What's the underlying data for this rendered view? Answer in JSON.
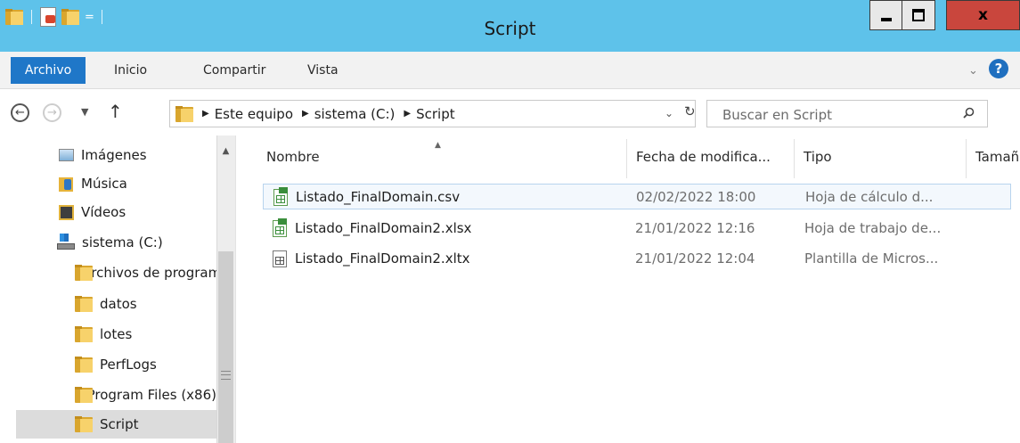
{
  "window": {
    "title": "Script",
    "close_glyph": "x"
  },
  "qat": {
    "dropdown_glyph": "="
  },
  "ribbon": {
    "tabs": [
      "Archivo",
      "Inicio",
      "Compartir",
      "Vista"
    ],
    "active_tab": "Archivo",
    "expand_glyph": "⌄",
    "help_glyph": "?"
  },
  "nav_buttons": {
    "back_glyph": "←",
    "forward_glyph": "→",
    "recent_glyph": "▼",
    "up_glyph": "↑"
  },
  "address": {
    "crumbs": [
      "Este equipo",
      "sistema (C:)",
      "Script"
    ],
    "separator_glyph": "▶",
    "dropdown_glyph": "⌄",
    "refresh_glyph": "↻"
  },
  "search": {
    "placeholder": "Buscar en Script"
  },
  "nav_pane": {
    "items": [
      {
        "label": "Imágenes",
        "icon": "pictures-icon",
        "indent": 1
      },
      {
        "label": "Música",
        "icon": "music-icon",
        "indent": 1
      },
      {
        "label": "Vídeos",
        "icon": "videos-icon",
        "indent": 1
      },
      {
        "label": "sistema (C:)",
        "icon": "drive-icon",
        "indent": 1
      },
      {
        "label": "Archivos de programa",
        "icon": "folder-icon",
        "indent": 2
      },
      {
        "label": "datos",
        "icon": "folder-icon",
        "indent": 2
      },
      {
        "label": "lotes",
        "icon": "folder-icon",
        "indent": 2
      },
      {
        "label": "PerfLogs",
        "icon": "folder-icon",
        "indent": 2
      },
      {
        "label": "Program Files (x86)",
        "icon": "folder-icon",
        "indent": 2
      },
      {
        "label": "Script",
        "icon": "folder-icon",
        "indent": 2,
        "selected": true
      }
    ],
    "scroll_up_glyph": "▲"
  },
  "file_list": {
    "sort_glyph": "▲",
    "columns": [
      "Nombre",
      "Fecha de modifica...",
      "Tipo",
      "Tamaño"
    ],
    "rows": [
      {
        "name": "Listado_FinalDomain.csv",
        "date": "02/02/2022 18:00",
        "type": "Hoja de cálculo d...",
        "icon": "excel-csv-icon",
        "selected": true
      },
      {
        "name": "Listado_FinalDomain2.xlsx",
        "date": "21/01/2022 12:16",
        "type": "Hoja de trabajo de...",
        "icon": "excel-xlsx-icon"
      },
      {
        "name": "Listado_FinalDomain2.xltx",
        "date": "21/01/2022 12:04",
        "type": "Plantilla de Micros...",
        "icon": "excel-template-icon"
      }
    ]
  },
  "colors": {
    "titlebar": "#5ec2ea",
    "accent": "#1f77c8",
    "close": "#c9463d",
    "folder": "#f7d26b"
  }
}
